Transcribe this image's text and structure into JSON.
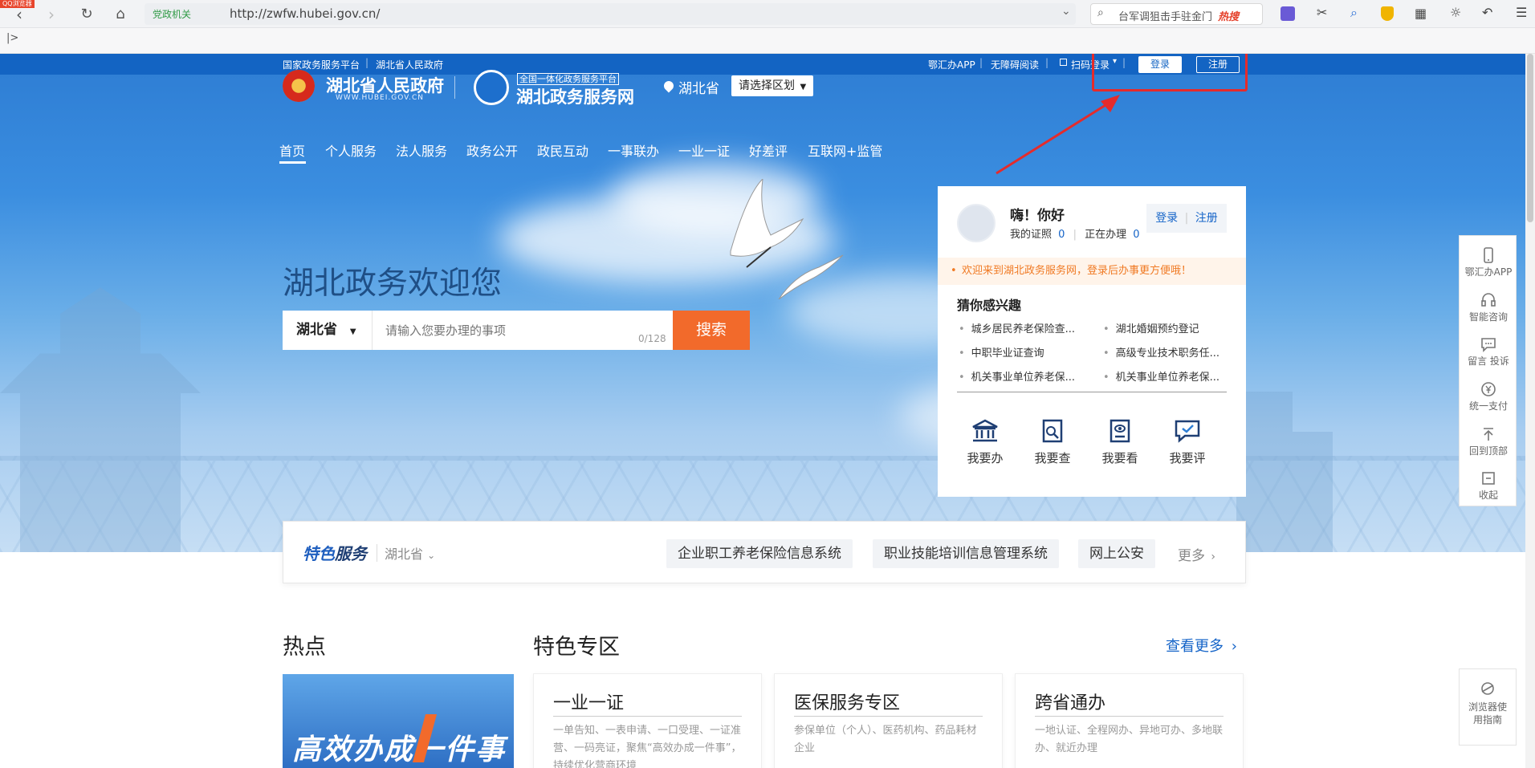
{
  "browser": {
    "corner_badge": "QQ浏览器",
    "site_tag": "党政机关",
    "url": "http://zwfw.hubei.gov.cn/",
    "search_text": "台军调狙击手驻金门",
    "hot_label": "热搜"
  },
  "topbar": {
    "link1": "国家政务服务平台",
    "link2": "湖北省人民政府",
    "app_link": "鄂汇办APP",
    "accessible_link": "无障碍阅读",
    "scan_login": "扫码登录",
    "login_button": "登录",
    "register_button": "注册"
  },
  "header": {
    "gov_name": "湖北省人民政府",
    "gov_url": "WWW.HUBEI.GOV.CN",
    "platform_tag": "全国一体化政务服务平台",
    "platform_name": "湖北政务服务网",
    "region": "湖北省",
    "region_select": "请选择区划"
  },
  "nav": [
    "首页",
    "个人服务",
    "法人服务",
    "政务公开",
    "政民互动",
    "一事联办",
    "一业一证",
    "好差评",
    "互联网+监管"
  ],
  "hero": {
    "welcome": "湖北政务欢迎您",
    "search_region": "湖北省",
    "search_placeholder": "请输入您要办理的事项",
    "char_count": "0/128",
    "search_button": "搜索"
  },
  "user_panel": {
    "greeting": "嗨！你好",
    "cert_label": "我的证照",
    "cert_count": "0",
    "in_progress_label": "正在办理",
    "in_progress_count": "0",
    "login": "登录",
    "register": "注册",
    "notice": "欢迎来到湖北政务服务网，登录后办事更方便哦！",
    "guess_title": "猜你感兴趣",
    "guess_items": [
      "城乡居民养老保险查...",
      "湖北婚姻预约登记",
      "中职毕业证查询",
      "高级专业技术职务任...",
      "机关事业单位养老保...",
      "机关事业单位养老保..."
    ],
    "services": [
      "我要办",
      "我要查",
      "我要看",
      "我要评"
    ]
  },
  "featured": {
    "title_a": "特色",
    "title_b": "服务",
    "region": "湖北省",
    "tags": [
      "企业职工养老保险信息系统",
      "职业技能培训信息管理系统",
      "网上公安"
    ],
    "more": "更多"
  },
  "hot": {
    "title": "热点",
    "banner_text": "高效办成一件事"
  },
  "zones": {
    "title": "特色专区",
    "more": "查看更多",
    "items": [
      {
        "title": "一业一证",
        "desc": "一单告知、一表申请、一口受理、一证准营、一码亮证，聚焦“高效办成一件事”，持续优化营商环境"
      },
      {
        "title": "医保服务专区",
        "desc": "参保单位（个人）、医药机构、药品耗材企业"
      },
      {
        "title": "跨省通办",
        "desc": "一地认证、全程网办、异地可办、多地联办、就近办理"
      }
    ]
  },
  "sidebar": [
    "鄂汇办APP",
    "智能咨询",
    "留言 投诉",
    "统一支付",
    "回到顶部",
    "收起"
  ],
  "browser_guide": "浏览器使用指南",
  "colors": {
    "topbar": "#1364c3",
    "accent": "#1564c8",
    "search_button": "#f26a2b",
    "annotation": "#e52b2b"
  }
}
